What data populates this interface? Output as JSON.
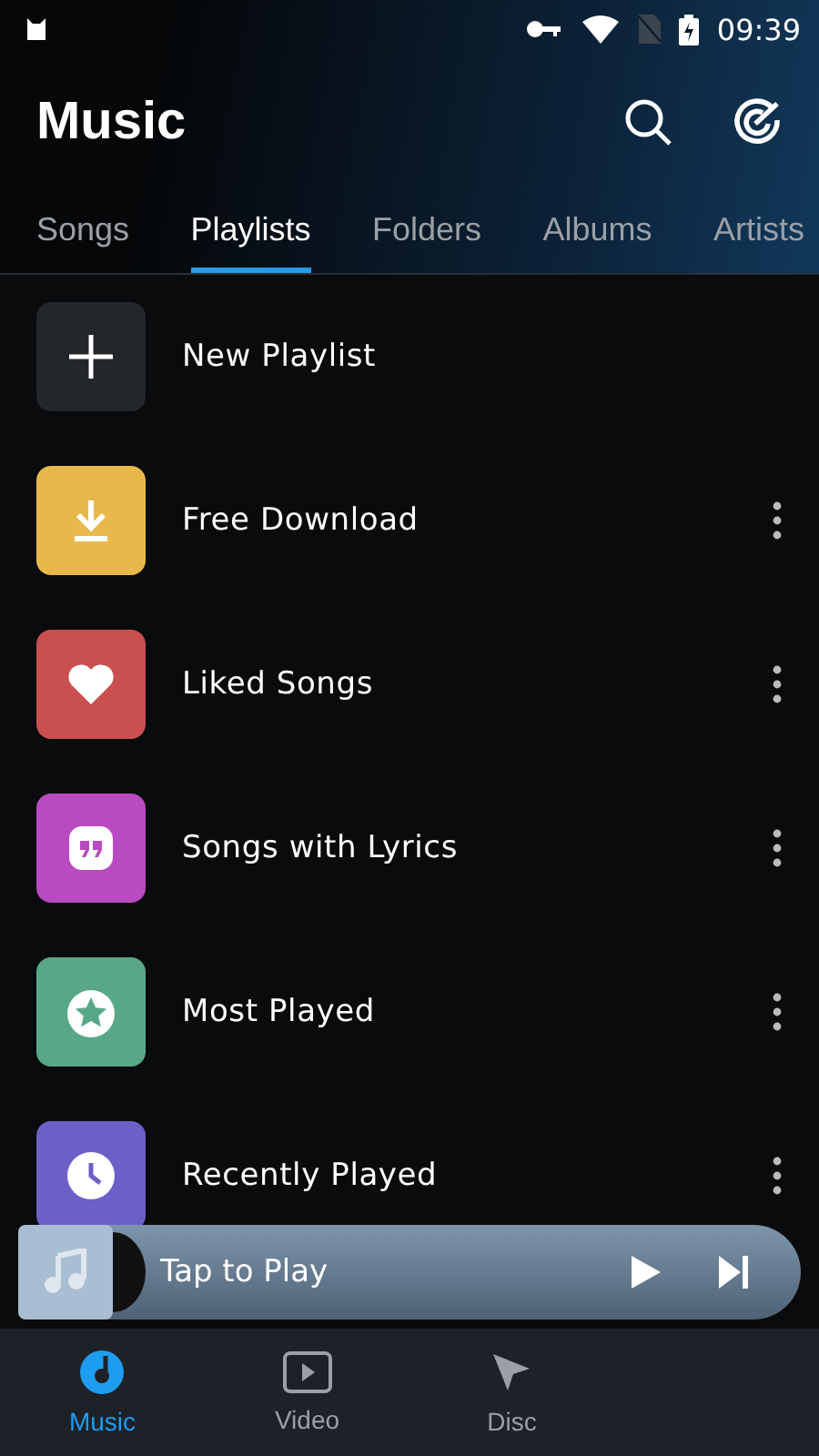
{
  "status_bar": {
    "time": "09:39"
  },
  "header": {
    "title": "Music"
  },
  "tabs": [
    {
      "label": "Songs",
      "selected": false
    },
    {
      "label": "Playlists",
      "selected": true
    },
    {
      "label": "Folders",
      "selected": false
    },
    {
      "label": "Albums",
      "selected": false
    },
    {
      "label": "Artists",
      "selected": false
    }
  ],
  "playlists": [
    {
      "name": "New Playlist",
      "kind": "add",
      "color": "#23272b",
      "menu": false
    },
    {
      "name": "Free Download",
      "kind": "download",
      "color": "#e8b94a",
      "menu": true
    },
    {
      "name": "Liked Songs",
      "kind": "heart",
      "color": "#c9504f",
      "menu": true
    },
    {
      "name": "Songs with Lyrics",
      "kind": "quote",
      "color": "#b84bc1",
      "menu": true
    },
    {
      "name": "Most Played",
      "kind": "star",
      "color": "#58a888",
      "menu": true
    },
    {
      "name": "Recently Played",
      "kind": "clock",
      "color": "#6c5fc7",
      "menu": true
    }
  ],
  "player": {
    "title": "Tap to Play"
  },
  "bottom_nav": [
    {
      "label": "Music",
      "kind": "music",
      "selected": true
    },
    {
      "label": "Video",
      "kind": "video",
      "selected": false
    },
    {
      "label": "Disc",
      "kind": "discover",
      "selected": false
    }
  ]
}
